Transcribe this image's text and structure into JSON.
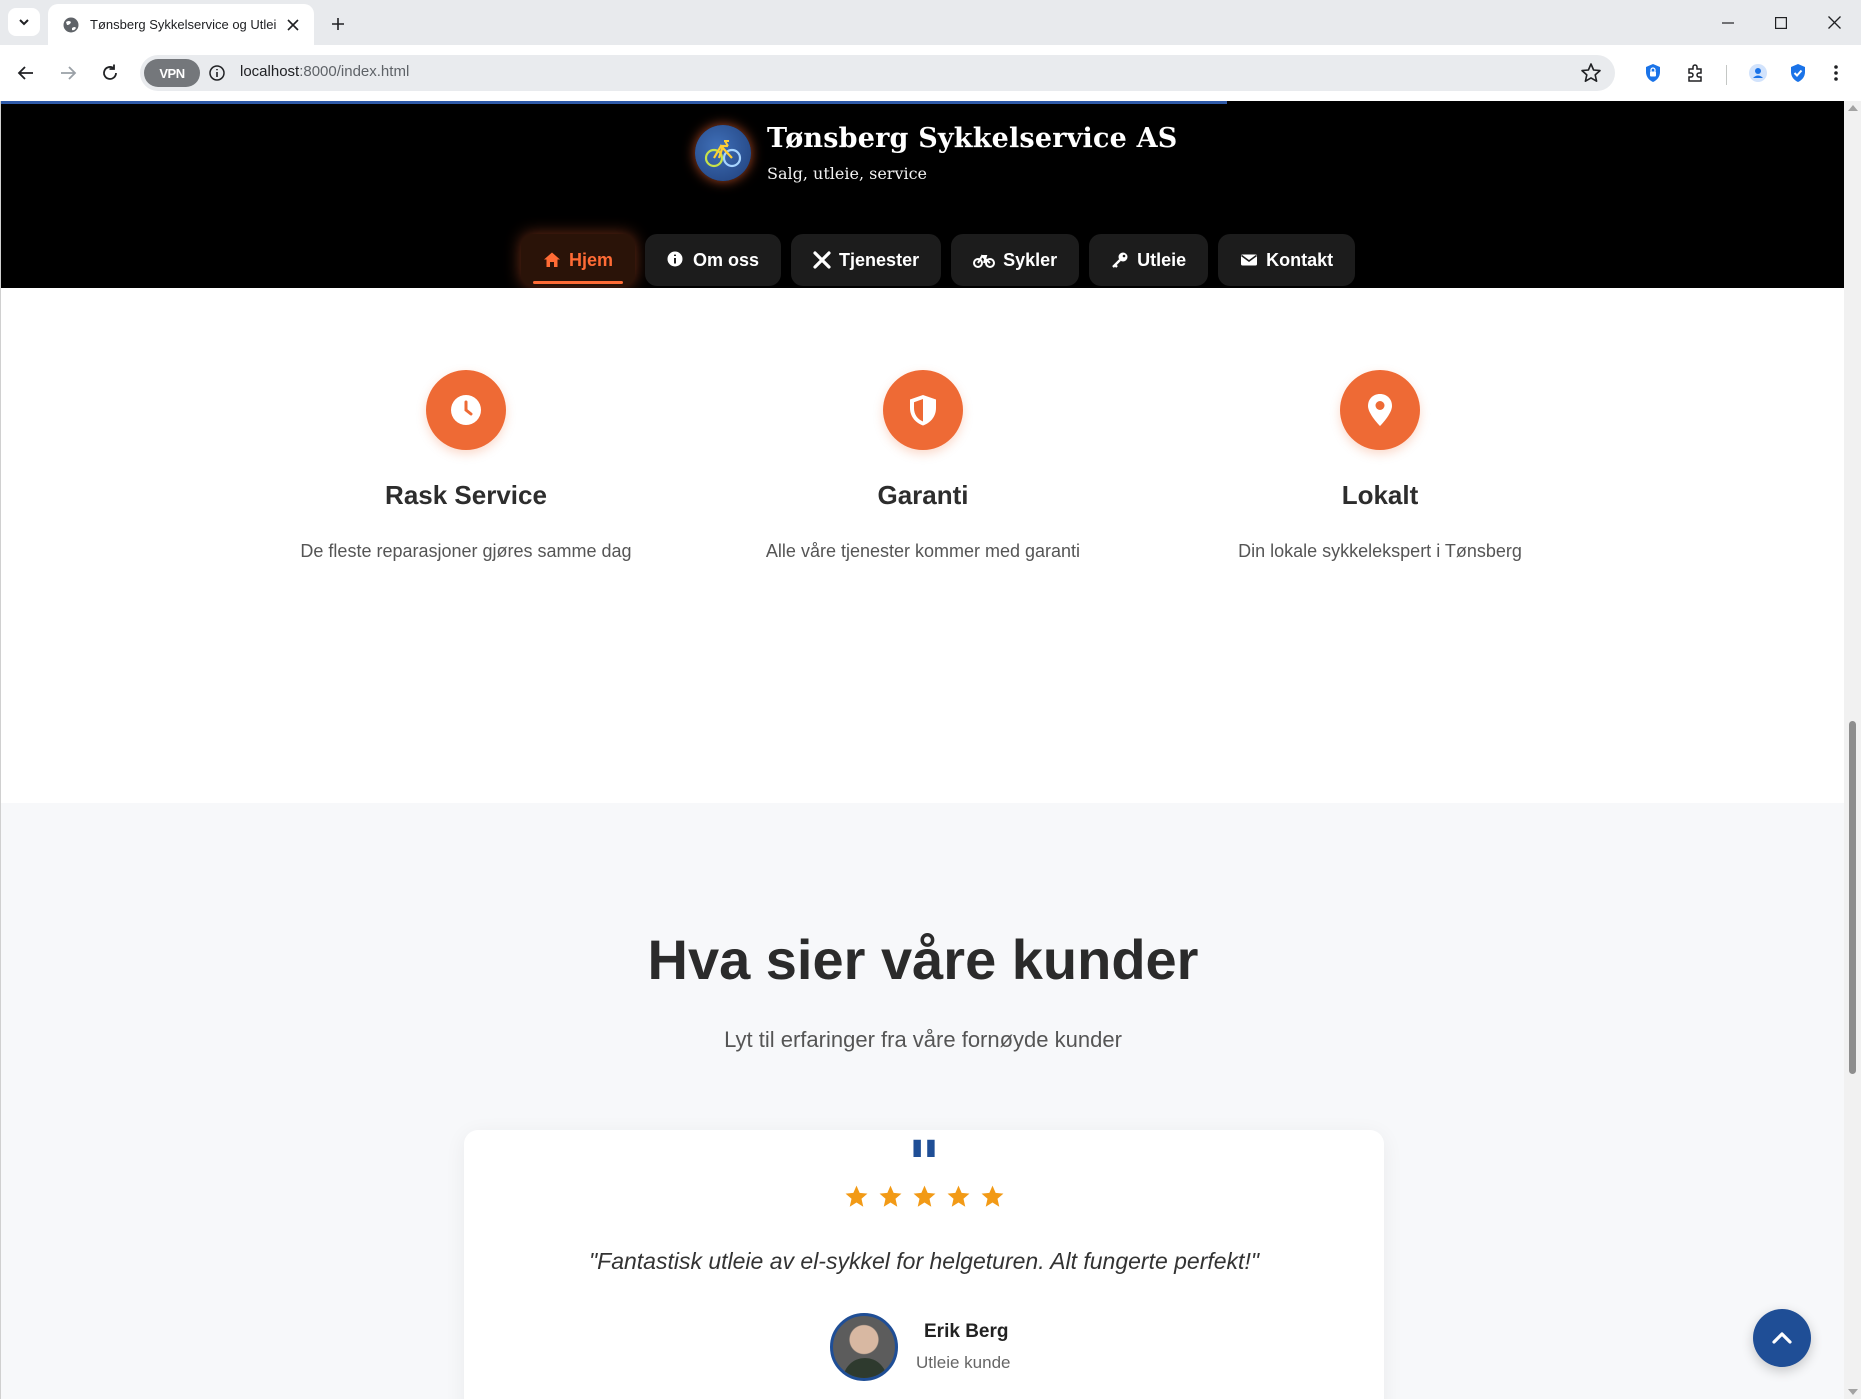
{
  "browser": {
    "tab_title": "Tønsberg Sykkelservice og Utleie",
    "url_host": "localhost",
    "url_rest": ":8000/index.html",
    "vpn_label": "VPN"
  },
  "site": {
    "title": "Tønsberg Sykkelservice AS",
    "subtitle": "Salg, utleie, service",
    "nav": [
      {
        "label": "Hjem",
        "icon": "home-icon",
        "active": true
      },
      {
        "label": "Om oss",
        "icon": "info-icon"
      },
      {
        "label": "Tjenester",
        "icon": "tools-icon"
      },
      {
        "label": "Sykler",
        "icon": "bicycle-icon"
      },
      {
        "label": "Utleie",
        "icon": "key-icon"
      },
      {
        "label": "Kontakt",
        "icon": "envelope-icon"
      }
    ]
  },
  "features": [
    {
      "icon": "clock-icon",
      "title": "Rask Service",
      "text": "De fleste reparasjoner gjøres samme dag"
    },
    {
      "icon": "shield-icon",
      "title": "Garanti",
      "text": "Alle våre tjenester kommer med garanti"
    },
    {
      "icon": "map-pin-icon",
      "title": "Lokalt",
      "text": "Din lokale sykkelekspert i Tønsberg"
    }
  ],
  "testimonials": {
    "heading": "Hva sier våre kunder",
    "subheading": "Lyt til erfaringer fra våre fornøyde kunder",
    "quote_mark": "\"",
    "rating": 5,
    "text": "\"Fantastisk utleie av el-sykkel for helgeturen. Alt fungerte perfekt!\"",
    "name": "Erik Berg",
    "role": "Utleie kunde"
  },
  "colors": {
    "accent": "#ee6a35",
    "brand_blue": "#1f4e96",
    "star": "#f29a16"
  }
}
